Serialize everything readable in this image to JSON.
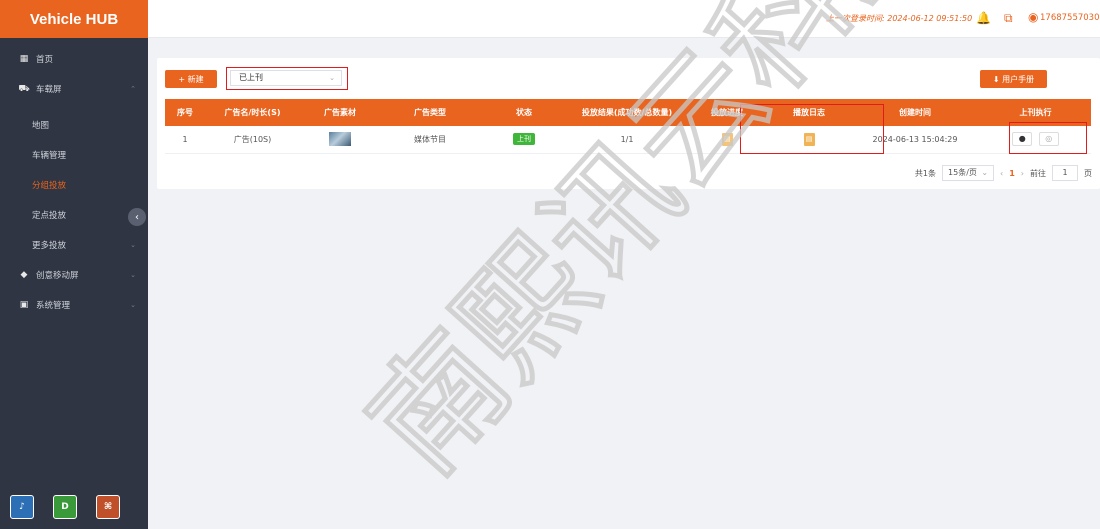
{
  "app": {
    "logo": "Vehicle HUB"
  },
  "sidebar": {
    "items": [
      {
        "label": "首页",
        "icon": "dashboard-icon"
      },
      {
        "label": "车载屏",
        "icon": "car-icon"
      },
      {
        "label": "地图"
      },
      {
        "label": "车辆管理"
      },
      {
        "label": "分组投放"
      },
      {
        "label": "定点投放"
      },
      {
        "label": "更多投放"
      },
      {
        "label": "创意移动屏",
        "icon": "bag-icon"
      },
      {
        "label": "系统管理",
        "icon": "system-icon"
      }
    ],
    "collapse_glyph": "‹",
    "chevron_glyph": "⌄",
    "bottom_apps": [
      {
        "name": "app-icon-1",
        "glyph": "♪"
      },
      {
        "name": "app-icon-2",
        "glyph": "D"
      },
      {
        "name": "app-icon-3",
        "glyph": "⌘"
      }
    ]
  },
  "header": {
    "last_login": "上一次登录时间: 2024-06-12 09:51:50",
    "user": "17687557030"
  },
  "toolbar": {
    "new_label": "+ 新建",
    "filter_value": "已上刊",
    "manual_label": "⬇ 用户手册"
  },
  "table": {
    "headers": {
      "index": "序号",
      "name": "广告名/时长(S)",
      "material": "广告素材",
      "type": "广告类型",
      "status": "状态",
      "result": "投放结果(成功数/总数量)",
      "progress": "投放进度",
      "log": "播放日志",
      "created": "创建时间",
      "action": "上刊执行"
    },
    "rows": [
      {
        "index": "1",
        "name": "广告(10S)",
        "type": "媒体节目",
        "status": "上刊",
        "result": "1/1",
        "created": "2024-06-13 15:04:29"
      }
    ]
  },
  "pagination": {
    "total": "共1条",
    "page_size": "15条/页",
    "current": "1",
    "goto_label": "前往",
    "goto_value": "1",
    "page_suffix": "页"
  },
  "watermark": {
    "text": "南熙讯云科技有",
    "color": "#bfbfbf"
  },
  "colors": {
    "accent": "#e8641f",
    "sidebar_bg": "#2f3542",
    "highlight_box": "#e01c1c",
    "success": "#3fb53a"
  }
}
